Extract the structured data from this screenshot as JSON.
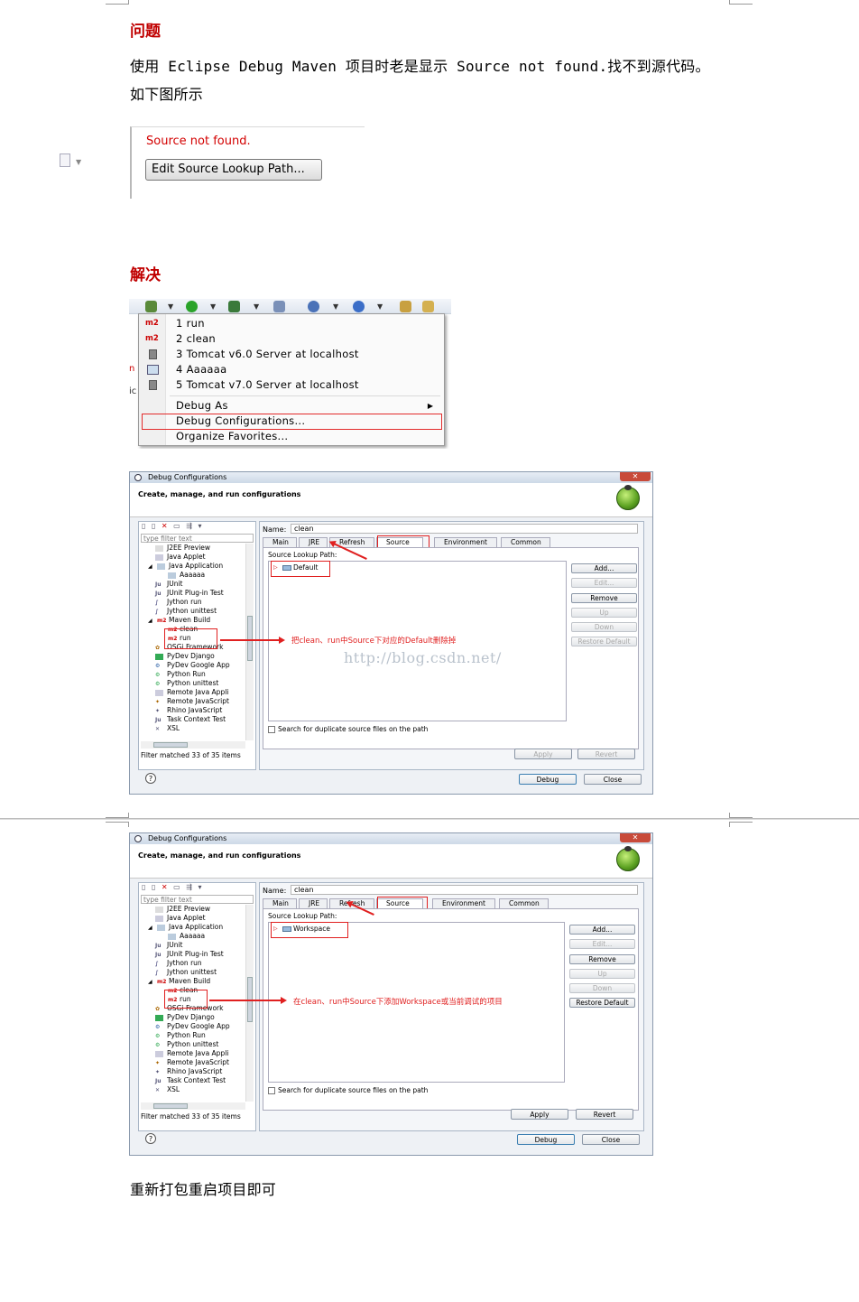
{
  "heading_problem": "问题",
  "problem_line1": "使用 Eclipse Debug Maven 项目时老是显示 Source not found.找不到源代码。",
  "problem_line2": "如下图所示",
  "source_not_found": {
    "message": "Source not found.",
    "button": "Edit Source Lookup Path..."
  },
  "heading_solution": "解决",
  "debug_menu": {
    "items": [
      {
        "icon": "m2",
        "label": "1 run"
      },
      {
        "icon": "m2",
        "label": "2 clean"
      },
      {
        "icon": "server-icon",
        "label": "3 Tomcat v6.0 Server at localhost"
      },
      {
        "icon": "java-app-icon",
        "label": "4 Aaaaaa"
      },
      {
        "icon": "server-icon",
        "label": "5 Tomcat v7.0 Server at localhost"
      }
    ],
    "debug_as": "Debug As",
    "debug_configurations": "Debug Configurations...",
    "organize_favorites": "Organize Favorites..."
  },
  "dialog1": {
    "title": "Debug Configurations",
    "header": "Create, manage, and run configurations",
    "filter_placeholder": "type filter text",
    "tree": [
      "J2EE Preview",
      "Java Applet",
      "Java Application",
      "Aaaaaa",
      "JUnit",
      "JUnit Plug-in Test",
      "Jython run",
      "Jython unittest",
      "Maven Build",
      "clean",
      "run",
      "OSGi Framework",
      "PyDev Django",
      "PyDev Google App",
      "Python Run",
      "Python unittest",
      "Remote Java Appli",
      "Remote JavaScript",
      "Rhino JavaScript",
      "Task Context Test",
      "XSL"
    ],
    "filter_matched": "Filter matched 33 of 35 items",
    "name_label": "Name:",
    "name_value": "clean",
    "tabs": [
      "Main",
      "JRE",
      "Refresh",
      "Source",
      "Environment",
      "Common"
    ],
    "source_lookup_path": "Source Lookup Path:",
    "lookup_entry": "Default",
    "side_buttons": [
      "Add...",
      "Edit...",
      "Remove",
      "Up",
      "Down",
      "Restore Default"
    ],
    "search_dup": "Search for duplicate source files on the path",
    "apply": "Apply",
    "revert": "Revert",
    "debug": "Debug",
    "close": "Close",
    "annotation": "把clean、run中Source下对应的Default删除掉",
    "watermark": "http://blog.csdn.net/"
  },
  "dialog2": {
    "title": "Debug Configurations",
    "header": "Create, manage, and run configurations",
    "filter_placeholder": "type filter text",
    "filter_matched": "Filter matched 33 of 35 items",
    "name_label": "Name:",
    "name_value": "clean",
    "source_lookup_path": "Source Lookup Path:",
    "lookup_entry": "Workspace",
    "search_dup": "Search for duplicate source files on the path",
    "apply": "Apply",
    "revert": "Revert",
    "debug": "Debug",
    "close": "Close",
    "annotation": "在clean、run中Source下添加Workspace或当前调试的项目"
  },
  "conclusion": "重新打包重启项目即可"
}
